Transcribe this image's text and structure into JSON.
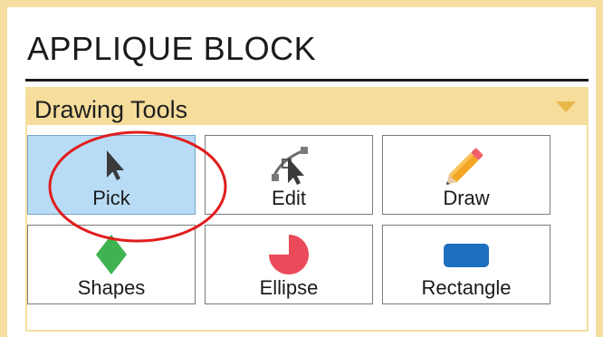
{
  "panel": {
    "title": "APPLIQUE BLOCK"
  },
  "section": {
    "title": "Drawing Tools",
    "collapse_icon": "triangle-down-icon",
    "header_color": "#f6dd9b"
  },
  "tools": [
    {
      "label": "Pick",
      "icon": "cursor-arrow-icon",
      "selected": true
    },
    {
      "label": "Edit",
      "icon": "edit-nodes-icon",
      "selected": false
    },
    {
      "label": "Draw",
      "icon": "pencil-icon",
      "selected": false
    },
    {
      "label": "Shapes",
      "icon": "green-diamond-icon",
      "selected": false
    },
    {
      "label": "Ellipse",
      "icon": "pie-ellipse-icon",
      "selected": false
    },
    {
      "label": "Rectangle",
      "icon": "blue-rounded-rectangle-icon",
      "selected": false
    }
  ],
  "colors": {
    "frame": "#f5dfa0",
    "selected_fill": "#b9dcf6",
    "highlight_ring": "#e11d1d",
    "shapes_green": "#3fb34f",
    "ellipse_red": "#ea4a5a",
    "rectangle_blue": "#1f6fbf"
  }
}
